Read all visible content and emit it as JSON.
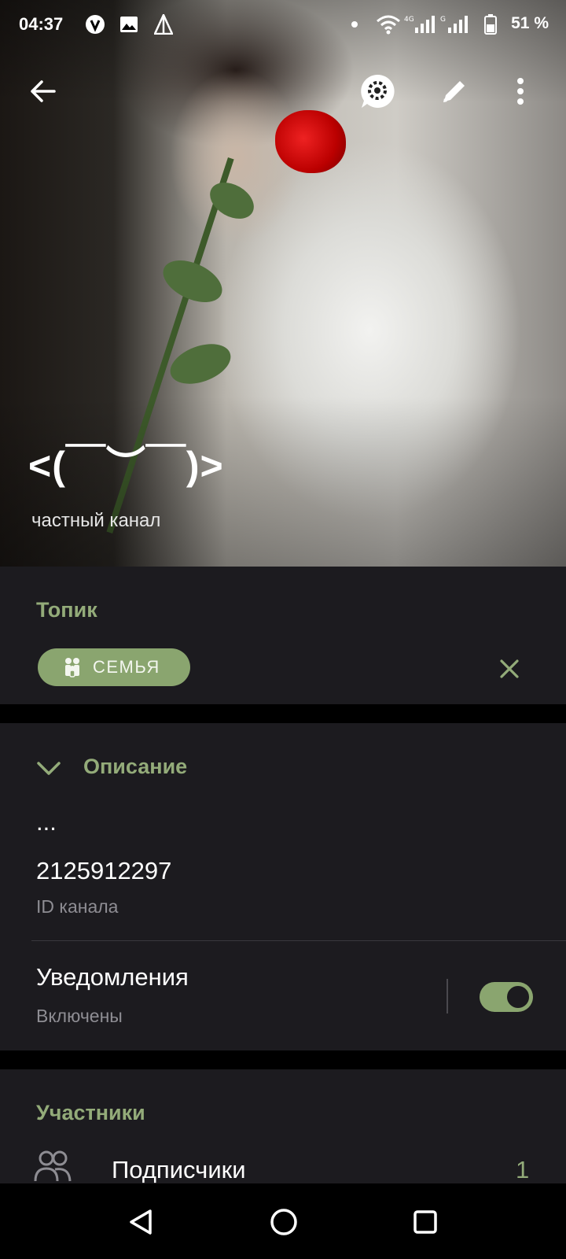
{
  "status_bar": {
    "time": "04:37",
    "icons": [
      "v-app-icon",
      "gallery-icon",
      "vpn-triangle-icon",
      "dot-icon",
      "wifi-icon",
      "signal-4g-icon",
      "signal-g-icon"
    ],
    "network_1": "4G",
    "network_2": "G",
    "battery": "51 %"
  },
  "header": {
    "back_icon": "arrow-left-icon",
    "actions": [
      "chat-settings-icon",
      "pencil-icon",
      "more-vertical-icon"
    ],
    "title": "<(￣︶￣)>",
    "subtitle": "частный канал"
  },
  "topic": {
    "heading": "Топик",
    "chip_label": "СЕМЬЯ",
    "chip_icon": "family-icon",
    "remove_icon": "close-icon"
  },
  "description": {
    "heading": "Описание",
    "text": "...",
    "channel_id": "2125912297",
    "channel_id_label": "ID канала",
    "notifications_label": "Уведомления",
    "notifications_status": "Включены",
    "notifications_enabled": true
  },
  "members": {
    "heading": "Участники",
    "subscribers_label": "Подписчики",
    "subscribers_count": "1"
  },
  "colors": {
    "accent": "#93ab79",
    "chip": "#8aa56f",
    "surface": "#1c1b1f",
    "background": "#000000"
  }
}
